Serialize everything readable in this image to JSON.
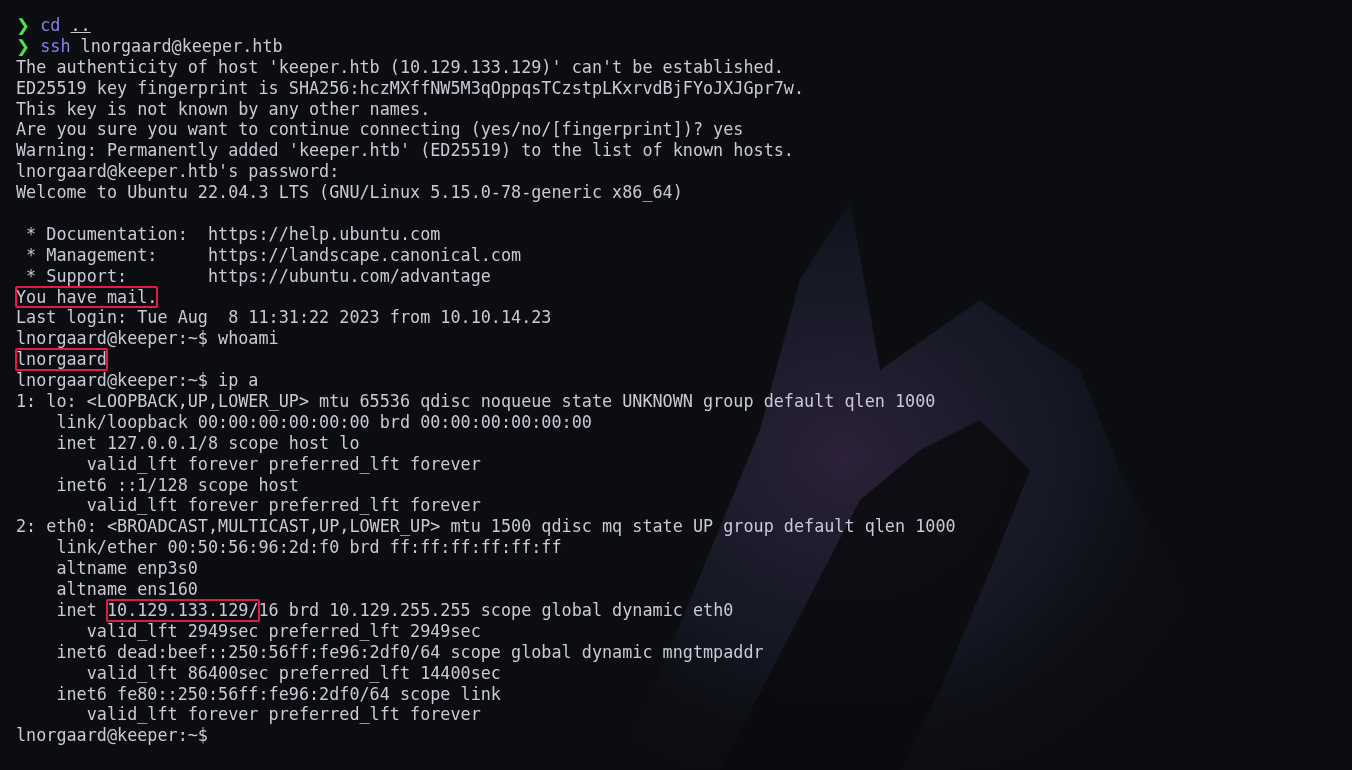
{
  "terminal": {
    "lines": [
      {
        "kind": "prompt",
        "symbol": "❯",
        "command": "cd",
        "argument": "..",
        "underlined": true
      },
      {
        "kind": "prompt",
        "symbol": "❯",
        "command": "ssh",
        "argument": "lnorgaard@keeper.htb",
        "underlined": false
      },
      {
        "kind": "output",
        "segments": [
          {
            "text": "The authenticity of host 'keeper.htb (10.129.133.129)' can't be established.",
            "highlighted": false
          }
        ]
      },
      {
        "kind": "output",
        "segments": [
          {
            "text": "ED25519 key fingerprint is SHA256:hczMXffNW5M3qOppqsTCzstpLKxrvdBjFYoJXJGpr7w.",
            "highlighted": false
          }
        ]
      },
      {
        "kind": "output",
        "segments": [
          {
            "text": "This key is not known by any other names.",
            "highlighted": false
          }
        ]
      },
      {
        "kind": "output",
        "segments": [
          {
            "text": "Are you sure you want to continue connecting (yes/no/[fingerprint])? yes",
            "highlighted": false
          }
        ]
      },
      {
        "kind": "output",
        "segments": [
          {
            "text": "Warning: Permanently added 'keeper.htb' (ED25519) to the list of known hosts.",
            "highlighted": false
          }
        ]
      },
      {
        "kind": "output",
        "segments": [
          {
            "text": "lnorgaard@keeper.htb's password:",
            "highlighted": false
          }
        ]
      },
      {
        "kind": "output",
        "segments": [
          {
            "text": "Welcome to Ubuntu 22.04.3 LTS (GNU/Linux 5.15.0-78-generic x86_64)",
            "highlighted": false
          }
        ]
      },
      {
        "kind": "blank"
      },
      {
        "kind": "output",
        "segments": [
          {
            "text": " * Documentation:  https://help.ubuntu.com",
            "highlighted": false
          }
        ]
      },
      {
        "kind": "output",
        "segments": [
          {
            "text": " * Management:     https://landscape.canonical.com",
            "highlighted": false
          }
        ]
      },
      {
        "kind": "output",
        "segments": [
          {
            "text": " * Support:        https://ubuntu.com/advantage",
            "highlighted": false
          }
        ]
      },
      {
        "kind": "output",
        "segments": [
          {
            "text": "You have mail.",
            "highlighted": true
          }
        ]
      },
      {
        "kind": "output",
        "segments": [
          {
            "text": "Last login: Tue Aug  8 11:31:22 2023 from 10.10.14.23",
            "highlighted": false
          }
        ]
      },
      {
        "kind": "output",
        "segments": [
          {
            "text": "lnorgaard@keeper:~$ whoami",
            "highlighted": false
          }
        ]
      },
      {
        "kind": "output",
        "segments": [
          {
            "text": "lnorgaard",
            "highlighted": true
          }
        ]
      },
      {
        "kind": "output",
        "segments": [
          {
            "text": "lnorgaard@keeper:~$ ip a",
            "highlighted": false
          }
        ]
      },
      {
        "kind": "output",
        "segments": [
          {
            "text": "1: lo: <LOOPBACK,UP,LOWER_UP> mtu 65536 qdisc noqueue state UNKNOWN group default qlen 1000",
            "highlighted": false
          }
        ]
      },
      {
        "kind": "output",
        "segments": [
          {
            "text": "    link/loopback 00:00:00:00:00:00 brd 00:00:00:00:00:00",
            "highlighted": false
          }
        ]
      },
      {
        "kind": "output",
        "segments": [
          {
            "text": "    inet 127.0.0.1/8 scope host lo",
            "highlighted": false
          }
        ]
      },
      {
        "kind": "output",
        "segments": [
          {
            "text": "       valid_lft forever preferred_lft forever",
            "highlighted": false
          }
        ]
      },
      {
        "kind": "output",
        "segments": [
          {
            "text": "    inet6 ::1/128 scope host",
            "highlighted": false
          }
        ]
      },
      {
        "kind": "output",
        "segments": [
          {
            "text": "       valid_lft forever preferred_lft forever",
            "highlighted": false
          }
        ]
      },
      {
        "kind": "output",
        "segments": [
          {
            "text": "2: eth0: <BROADCAST,MULTICAST,UP,LOWER_UP> mtu 1500 qdisc mq state UP group default qlen 1000",
            "highlighted": false
          }
        ]
      },
      {
        "kind": "output",
        "segments": [
          {
            "text": "    link/ether 00:50:56:96:2d:f0 brd ff:ff:ff:ff:ff:ff",
            "highlighted": false
          }
        ]
      },
      {
        "kind": "output",
        "segments": [
          {
            "text": "    altname enp3s0",
            "highlighted": false
          }
        ]
      },
      {
        "kind": "output",
        "segments": [
          {
            "text": "    altname ens160",
            "highlighted": false
          }
        ]
      },
      {
        "kind": "output",
        "segments": [
          {
            "text": "    inet ",
            "highlighted": false
          },
          {
            "text": "10.129.133.129/",
            "highlighted": true
          },
          {
            "text": "16 brd 10.129.255.255 scope global dynamic eth0",
            "highlighted": false
          }
        ]
      },
      {
        "kind": "output",
        "segments": [
          {
            "text": "       valid_lft 2949sec preferred_lft 2949sec",
            "highlighted": false
          }
        ]
      },
      {
        "kind": "output",
        "segments": [
          {
            "text": "    inet6 dead:beef::250:56ff:fe96:2df0/64 scope global dynamic mngtmpaddr",
            "highlighted": false
          }
        ]
      },
      {
        "kind": "output",
        "segments": [
          {
            "text": "       valid_lft 86400sec preferred_lft 14400sec",
            "highlighted": false
          }
        ]
      },
      {
        "kind": "output",
        "segments": [
          {
            "text": "    inet6 fe80::250:56ff:fe96:2df0/64 scope link",
            "highlighted": false
          }
        ]
      },
      {
        "kind": "output",
        "segments": [
          {
            "text": "       valid_lft forever preferred_lft forever",
            "highlighted": false
          }
        ]
      },
      {
        "kind": "output",
        "segments": [
          {
            "text": "lnorgaard@keeper:~$",
            "highlighted": false
          }
        ]
      }
    ]
  }
}
